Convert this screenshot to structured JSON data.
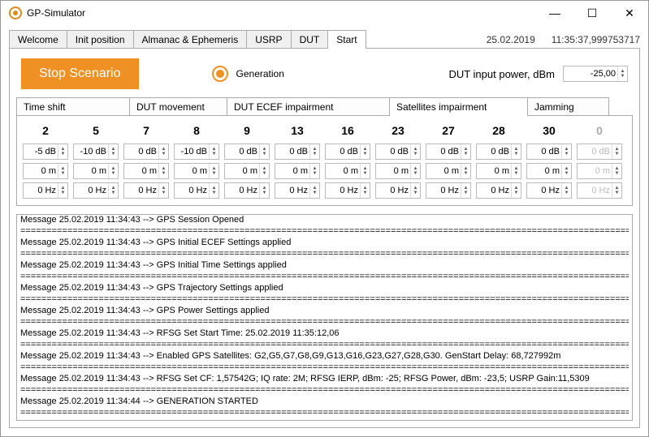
{
  "window": {
    "title": "GP-Simulator"
  },
  "header": {
    "date": "25.02.2019",
    "time": "11:35:37,999753717"
  },
  "tabs": {
    "items": [
      "Welcome",
      "Init position",
      "Almanac & Ephemeris",
      "USRP",
      "DUT",
      "Start"
    ],
    "active": 5
  },
  "controls": {
    "stop_label": "Stop Scenario",
    "generation_label": "Generation",
    "dut_power_label": "DUT input power, dBm",
    "dut_power_value": "-25,00"
  },
  "subtabs": {
    "items": [
      "Time shift",
      "DUT movement",
      "DUT ECEF impairment",
      "Satellites impairment",
      "Jamming"
    ],
    "active": 3
  },
  "sats": [
    {
      "sv": "2",
      "db": "-5 dB",
      "m": "0 m",
      "hz": "0 Hz",
      "en": true
    },
    {
      "sv": "5",
      "db": "-10 dB",
      "m": "0 m",
      "hz": "0 Hz",
      "en": true
    },
    {
      "sv": "7",
      "db": "0 dB",
      "m": "0 m",
      "hz": "0 Hz",
      "en": true
    },
    {
      "sv": "8",
      "db": "-10 dB",
      "m": "0 m",
      "hz": "0 Hz",
      "en": true
    },
    {
      "sv": "9",
      "db": "0 dB",
      "m": "0 m",
      "hz": "0 Hz",
      "en": true
    },
    {
      "sv": "13",
      "db": "0 dB",
      "m": "0 m",
      "hz": "0 Hz",
      "en": true
    },
    {
      "sv": "16",
      "db": "0 dB",
      "m": "0 m",
      "hz": "0 Hz",
      "en": true
    },
    {
      "sv": "23",
      "db": "0 dB",
      "m": "0 m",
      "hz": "0 Hz",
      "en": true
    },
    {
      "sv": "27",
      "db": "0 dB",
      "m": "0 m",
      "hz": "0 Hz",
      "en": true
    },
    {
      "sv": "28",
      "db": "0 dB",
      "m": "0 m",
      "hz": "0 Hz",
      "en": true
    },
    {
      "sv": "30",
      "db": "0 dB",
      "m": "0 m",
      "hz": "0 Hz",
      "en": true
    },
    {
      "sv": "0",
      "db": "0 dB",
      "m": "0 m",
      "hz": "0 Hz",
      "en": false
    }
  ],
  "log_lines": [
    "Message 25.02.2019 11:34:43 --> GPS Session Opened",
    "=",
    "Message 25.02.2019 11:34:43 --> GPS Initial ECEF Settings applied",
    "=",
    "Message 25.02.2019 11:34:43 --> GPS Initial Time Settings applied",
    "=",
    "Message 25.02.2019 11:34:43 --> GPS Trajectory Settings applied",
    "=",
    "Message 25.02.2019 11:34:43 --> GPS Power Settings applied",
    "=",
    "Message 25.02.2019 11:34:43 --> RFSG Set Start Time: 25.02.2019 11:35:12,06",
    "=",
    "Message 25.02.2019 11:34:43 --> Enabled GPS Satellites: G2,G5,G7,G8,G9,G13,G16,G23,G27,G28,G30.   GenStart Delay: 68,727992m",
    "=",
    "Message 25.02.2019 11:34:43 --> RFSG Set CF: 1,57542G;   IQ rate: 2M;   RFSG IERP, dBm: -25;   RFSG Power, dBm: -23,5;   USRP Gain:11,5309",
    "=",
    "Message 25.02.2019 11:34:44 --> GENERATION STARTED",
    "="
  ]
}
